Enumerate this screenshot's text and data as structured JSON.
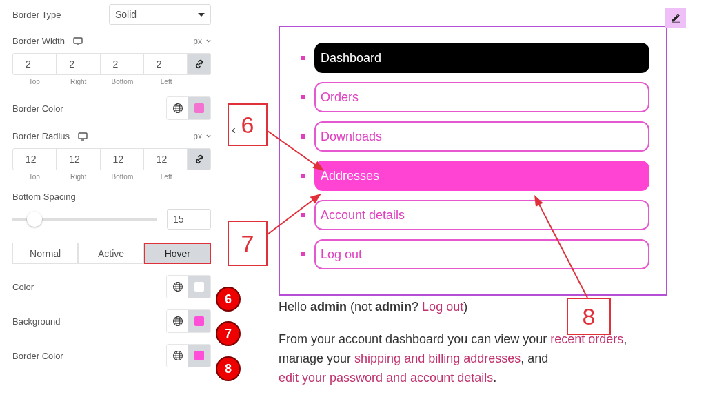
{
  "panel": {
    "controls": [
      {
        "kind": "select",
        "label": "Border Type",
        "value": "Solid"
      },
      {
        "kind": "dimensions",
        "label": "Border Width",
        "unit": "px",
        "linked": true,
        "fields": [
          {
            "value": "2",
            "label": "Top"
          },
          {
            "value": "2",
            "label": "Right"
          },
          {
            "value": "2",
            "label": "Bottom"
          },
          {
            "value": "2",
            "label": "Left"
          }
        ]
      },
      {
        "kind": "color",
        "label": "Border Color",
        "color": "#f472d0"
      },
      {
        "kind": "dimensions",
        "label": "Border Radius",
        "unit": "px",
        "linked": true,
        "fields": [
          {
            "value": "12",
            "label": "Top"
          },
          {
            "value": "12",
            "label": "Right"
          },
          {
            "value": "12",
            "label": "Bottom"
          },
          {
            "value": "12",
            "label": "Left"
          }
        ]
      },
      {
        "kind": "slider",
        "label": "Bottom Spacing",
        "level": 0.15,
        "value": "15"
      },
      {
        "kind": "tabs",
        "tabs": [
          {
            "label": "Normal",
            "selected": false
          },
          {
            "label": "Active",
            "selected": false
          },
          {
            "label": "Hover",
            "selected": true
          }
        ]
      },
      {
        "kind": "color",
        "label": "Color",
        "color": "#ffffff"
      },
      {
        "kind": "color",
        "label": "Background",
        "color": "#ff4fd8"
      },
      {
        "kind": "color",
        "label": "Border Color",
        "color": "#ff4fd8"
      }
    ]
  },
  "collapse_toggle": "‹",
  "nav": {
    "items": [
      {
        "label": "Dashboard",
        "selected": true,
        "hovered": false
      },
      {
        "label": "Orders",
        "selected": false,
        "hovered": false
      },
      {
        "label": "Downloads",
        "selected": false,
        "hovered": false
      },
      {
        "label": "Addresses",
        "selected": false,
        "hovered": true
      },
      {
        "label": "Account details",
        "selected": false,
        "hovered": false
      },
      {
        "label": "Log out",
        "selected": false,
        "hovered": false
      }
    ]
  },
  "greeting": [
    {
      "kind": "text",
      "text": "Hello **admin** (not **admin**? "
    },
    {
      "kind": "link",
      "text": "Log out"
    },
    {
      "kind": "text",
      "text": ")"
    }
  ],
  "intro": [
    {
      "kind": "text",
      "text": "From your account dashboard you can view your "
    },
    {
      "kind": "link",
      "text": "recent orders"
    },
    {
      "kind": "text",
      "text": ", manage your "
    },
    {
      "kind": "link",
      "text": "shipping and billing addresses"
    },
    {
      "kind": "text",
      "text": ", and "
    },
    {
      "kind": "link",
      "text": "edit your password and account details"
    },
    {
      "kind": "text",
      "text": "."
    }
  ],
  "annotations": {
    "callouts": [
      {
        "label": "6"
      },
      {
        "label": "7"
      },
      {
        "label": "8"
      }
    ],
    "badges": [
      {
        "label": "6"
      },
      {
        "label": "7"
      },
      {
        "label": "8"
      }
    ]
  }
}
